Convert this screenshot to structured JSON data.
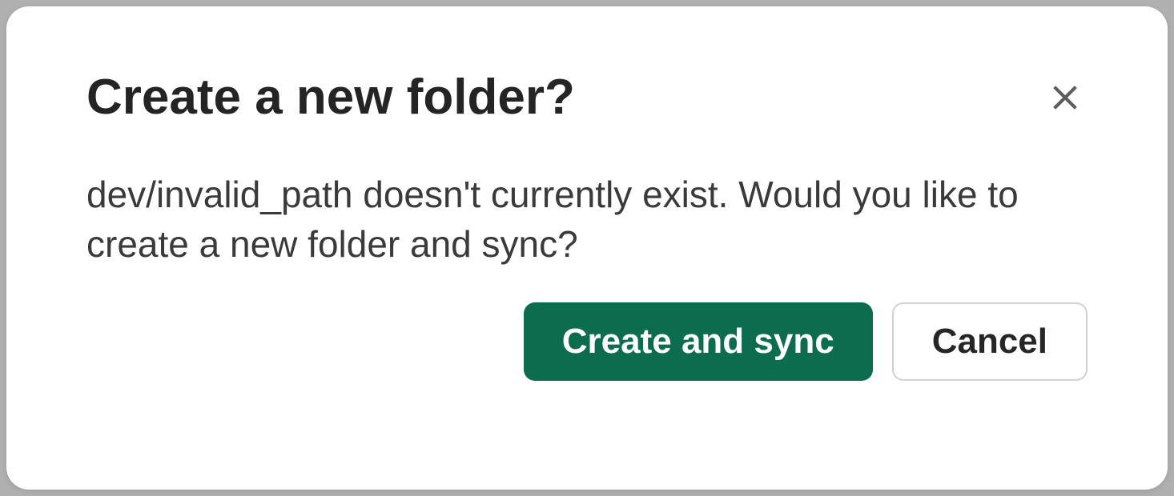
{
  "dialog": {
    "title": "Create a new folder?",
    "message": "dev/invalid_path doesn't currently exist. Would you like to create a new folder and sync?",
    "primary_button_label": "Create and sync",
    "secondary_button_label": "Cancel",
    "colors": {
      "primary": "#0c6c4e"
    }
  }
}
